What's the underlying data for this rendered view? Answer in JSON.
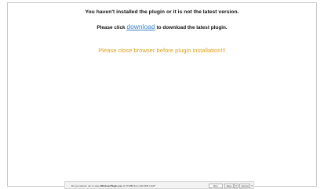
{
  "message": {
    "not_installed": "You haven't installed the plugin or it is not the latest version.",
    "click_prefix": "Please click ",
    "download_link": "download",
    "click_suffix": " to download the latest plugin.",
    "close_browser": "Please close browser before plugin installation!!!"
  },
  "download_bar": {
    "prompt_prefix": "Do you want to run or save ",
    "file_name": "WindowsPlugin.exe",
    "prompt_suffix": " (1.73 MB) from 192.168.1.112?",
    "run_label": "Run",
    "save_label": "Save",
    "menu_label": "▾",
    "cancel_label": "Cancel",
    "close_label": "×"
  },
  "colors": {
    "link": "#3a7fd0",
    "warning": "#e2a01a"
  }
}
